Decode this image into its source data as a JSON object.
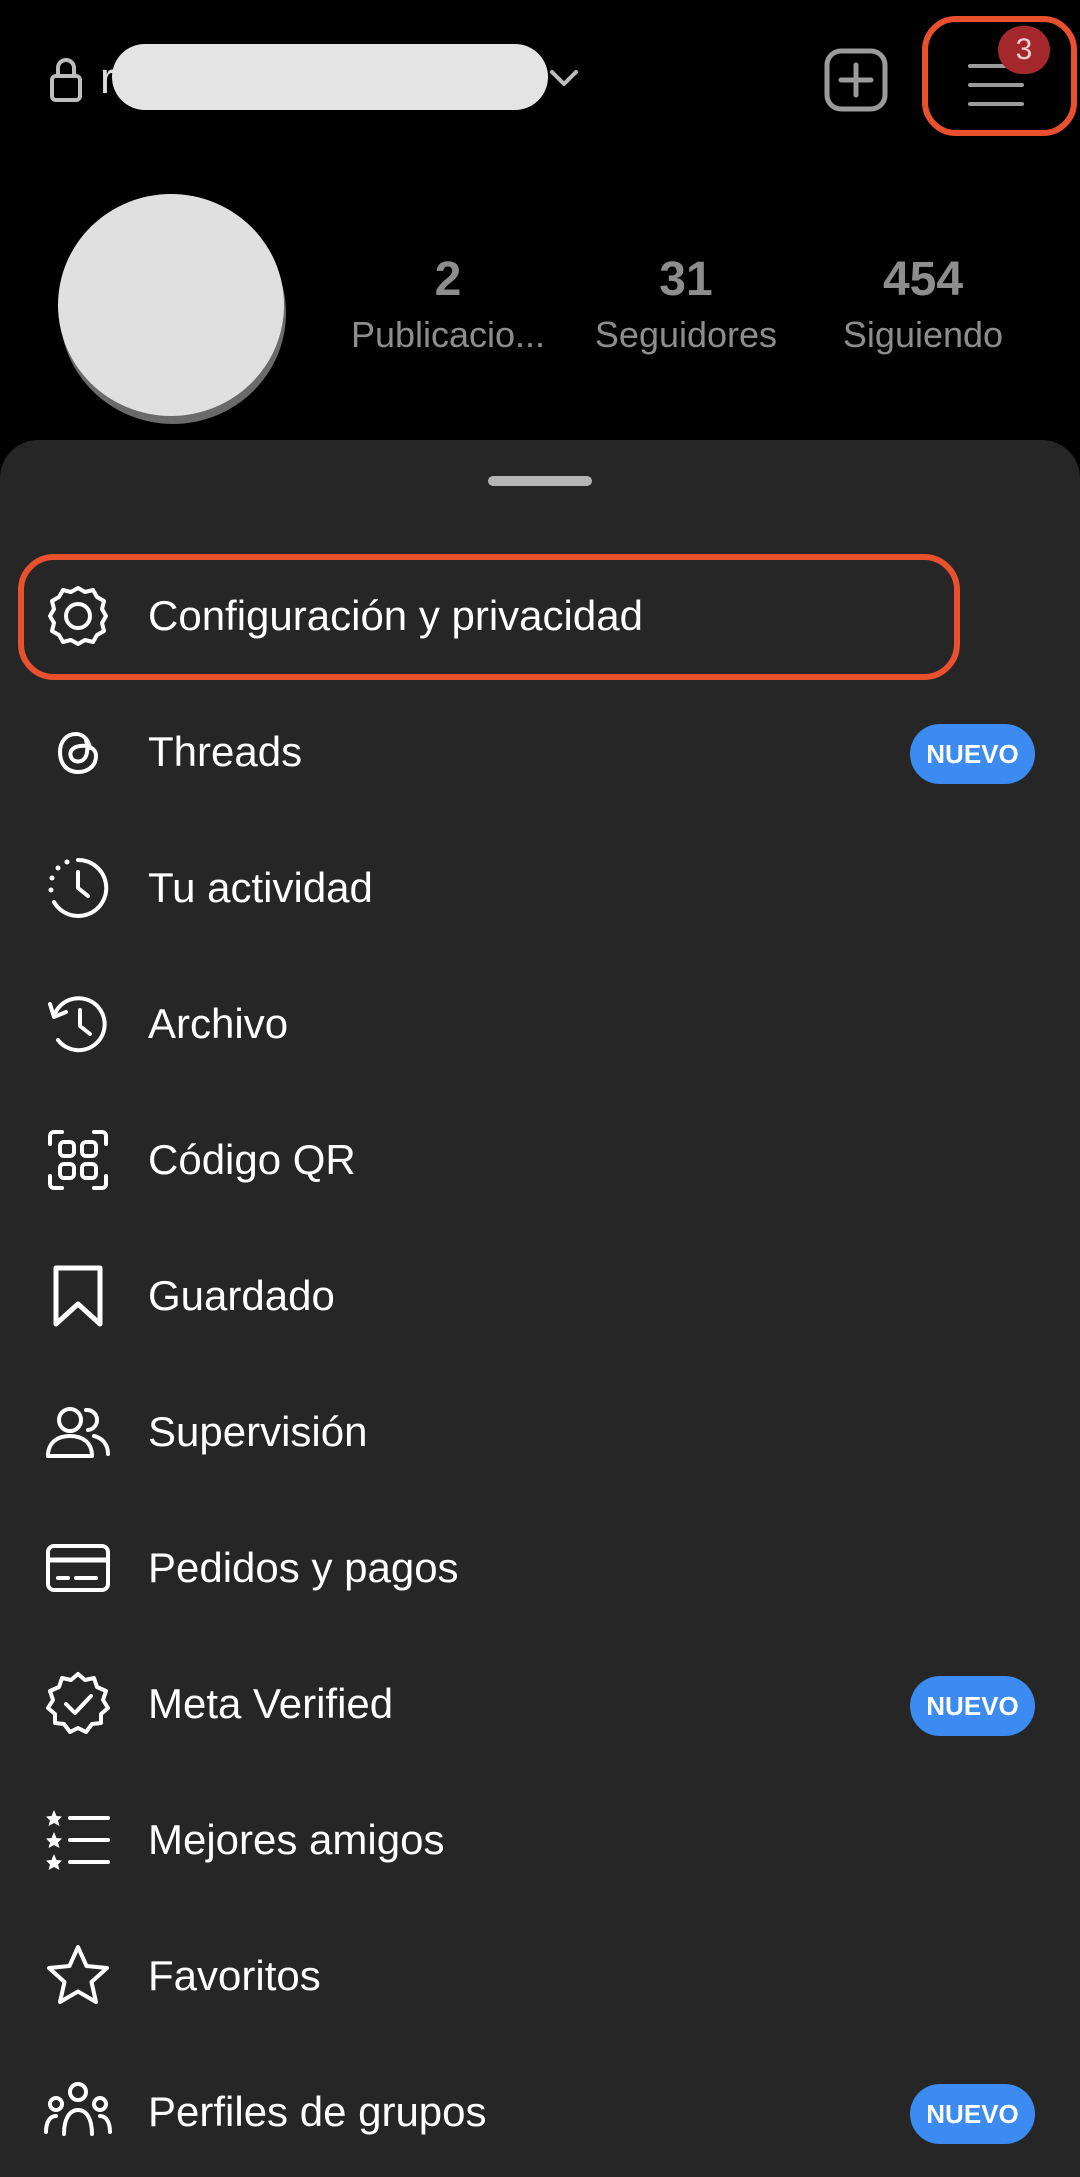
{
  "header": {
    "username_initial": "r",
    "menu_badge_count": "3"
  },
  "profile": {
    "stats": [
      {
        "number": "2",
        "label": "Publicacio..."
      },
      {
        "number": "31",
        "label": "Seguidores"
      },
      {
        "number": "454",
        "label": "Siguiendo"
      }
    ]
  },
  "menu": {
    "items": [
      {
        "label": "Configuración y privacidad",
        "icon": "gear-icon"
      },
      {
        "label": "Threads",
        "icon": "threads-icon",
        "badge": "NUEVO"
      },
      {
        "label": "Tu actividad",
        "icon": "activity-icon"
      },
      {
        "label": "Archivo",
        "icon": "archive-icon"
      },
      {
        "label": "Código QR",
        "icon": "qr-code-icon"
      },
      {
        "label": "Guardado",
        "icon": "bookmark-icon"
      },
      {
        "label": "Supervisión",
        "icon": "supervision-icon"
      },
      {
        "label": "Pedidos y pagos",
        "icon": "credit-card-icon"
      },
      {
        "label": "Meta Verified",
        "icon": "verified-badge-icon",
        "badge": "NUEVO"
      },
      {
        "label": "Mejores amigos",
        "icon": "close-friends-list-icon"
      },
      {
        "label": "Favoritos",
        "icon": "star-icon"
      },
      {
        "label": "Perfiles de grupos",
        "icon": "group-profiles-icon",
        "badge": "NUEVO"
      }
    ]
  },
  "colors": {
    "highlight": "#e8502e",
    "badge_blue": "#3b8bf0",
    "sheet_bg": "#262626",
    "notification_red": "#a3272c"
  }
}
